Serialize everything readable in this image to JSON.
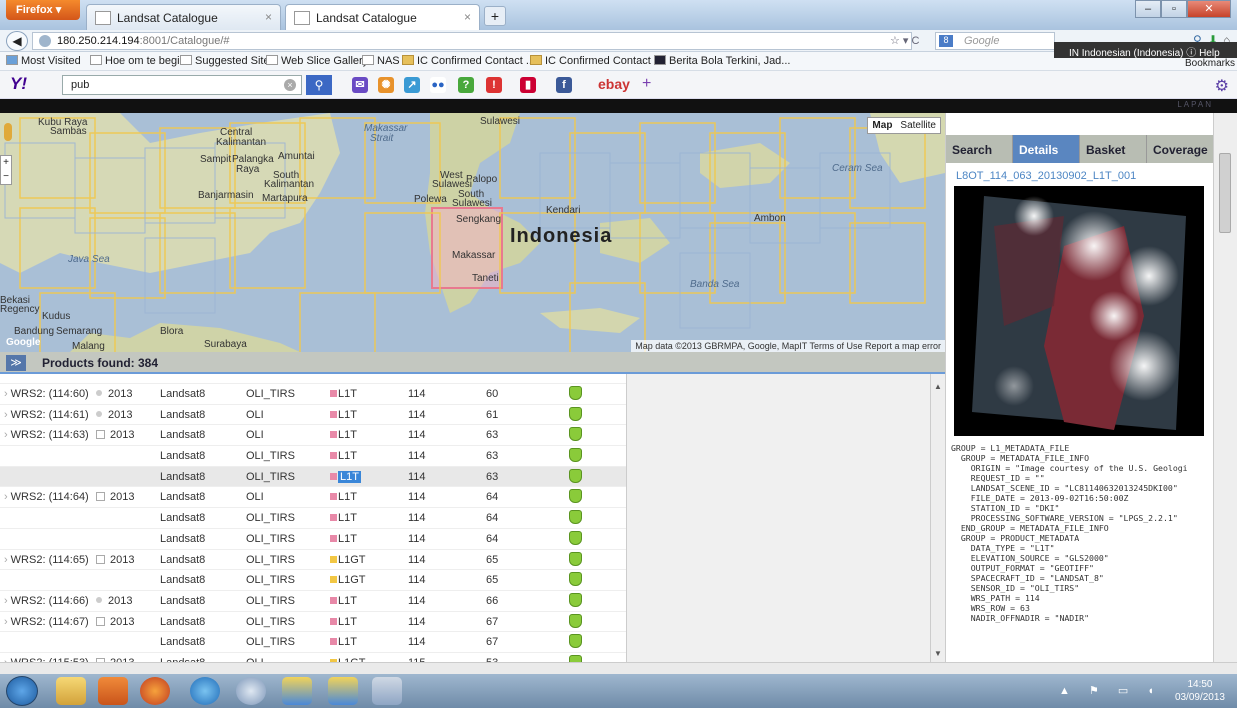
{
  "browser": {
    "menu_button": "Firefox ▾",
    "tabs": [
      {
        "label": "Landsat Catalogue"
      },
      {
        "label": "Landsat Catalogue"
      }
    ],
    "url_host": "180.250.214.194",
    "url_rest": ":8001/Catalogue/#",
    "nav_controls": "☆ ▾ C",
    "search_placeholder": "Google",
    "language_popup": "IN Indonesian (Indonesia)  ⓘ Help",
    "bookmarks_button": "Bookmarks",
    "bookmarks": [
      "Most Visited",
      "Hoe om te begin",
      "Suggested Sites",
      "Web Slice Gallery",
      "NAS",
      "IC Confirmed Contact ...",
      "IC Confirmed Contact ...",
      "Berita Bola Terkini, Jad..."
    ]
  },
  "yahoo": {
    "logo": "Y!",
    "query": "pub",
    "ebay": "ebay"
  },
  "app": {
    "brand": "LAPAN",
    "map": {
      "type_map": "Map",
      "type_satellite": "Satellite",
      "footer": "Map data ©2013 GBRMPA, Google, MapIT  Terms of Use  Report a map error",
      "labels": {
        "kubu": "Kubu Raya",
        "sambas": "Sambas",
        "central": "Central",
        "kalimantan": "Kalimantan",
        "makassar_strait": "Makassar",
        "strait": "Strait",
        "sulawesi": "Sulawesi",
        "sampit": "Sampit",
        "palangka": "Palangka",
        "raya": "Raya",
        "south": "South",
        "kalimantan2": "Kalimantan",
        "banjarmasin": "Banjarmasin",
        "martapura": "Martapura",
        "west": "West",
        "sulawesi2": "Sulawesi",
        "palopo": "Palopo",
        "polewa": "Polewa",
        "south2": "South",
        "sulawesi3": "Sulawesi",
        "sengkang": "Sengkang",
        "kendari": "Kendari",
        "indonesia": "Indonesia",
        "ceram_sea": "Ceram Sea",
        "ambon": "Ambon",
        "java_sea": "Java Sea",
        "makassar": "Makassar",
        "taneti": "Taneti",
        "banda_sea": "Banda Sea",
        "bekasi": "Bekasi",
        "regency": "Regency",
        "kudus": "Kudus",
        "bandung": "Bandung",
        "semarang": "Semarang",
        "blora": "Blora",
        "surabaya": "Surabaya",
        "malang": "Malang",
        "google": "Google",
        "muntai": "Amuntai"
      }
    },
    "products_header": "Products found: 384",
    "products": [
      {
        "wrs": "WRS2: (114:60)",
        "year": "2013",
        "sat": "Landsat8",
        "sensor": "OLI_TIRS",
        "level": "L1T",
        "level_color": "#e889a8",
        "path": "114",
        "row": "60",
        "group": false
      },
      {
        "wrs": "WRS2: (114:61)",
        "year": "2013",
        "sat": "Landsat8",
        "sensor": "OLI",
        "level": "L1T",
        "level_color": "#e889a8",
        "path": "114",
        "row": "61",
        "group": false
      },
      {
        "wrs": "WRS2: (114:63)",
        "year": "2013",
        "sat": "Landsat8",
        "sensor": "OLI",
        "level": "L1T",
        "level_color": "#e889a8",
        "path": "114",
        "row": "63",
        "group": true
      },
      {
        "wrs": "",
        "year": "",
        "sat": "Landsat8",
        "sensor": "OLI_TIRS",
        "level": "L1T",
        "level_color": "#e889a8",
        "path": "114",
        "row": "63",
        "group": false
      },
      {
        "wrs": "",
        "year": "",
        "sat": "Landsat8",
        "sensor": "OLI_TIRS",
        "level": "L1T",
        "level_color": "#e889a8",
        "path": "114",
        "row": "63",
        "group": false,
        "selected": true
      },
      {
        "wrs": "WRS2: (114:64)",
        "year": "2013",
        "sat": "Landsat8",
        "sensor": "OLI",
        "level": "L1T",
        "level_color": "#e889a8",
        "path": "114",
        "row": "64",
        "group": true
      },
      {
        "wrs": "",
        "year": "",
        "sat": "Landsat8",
        "sensor": "OLI_TIRS",
        "level": "L1T",
        "level_color": "#e889a8",
        "path": "114",
        "row": "64",
        "group": false
      },
      {
        "wrs": "",
        "year": "",
        "sat": "Landsat8",
        "sensor": "OLI_TIRS",
        "level": "L1T",
        "level_color": "#e889a8",
        "path": "114",
        "row": "64",
        "group": false
      },
      {
        "wrs": "WRS2: (114:65)",
        "year": "2013",
        "sat": "Landsat8",
        "sensor": "OLI_TIRS",
        "level": "L1GT",
        "level_color": "#f2c744",
        "path": "114",
        "row": "65",
        "group": true
      },
      {
        "wrs": "",
        "year": "",
        "sat": "Landsat8",
        "sensor": "OLI_TIRS",
        "level": "L1GT",
        "level_color": "#f2c744",
        "path": "114",
        "row": "65",
        "group": false
      },
      {
        "wrs": "WRS2: (114:66)",
        "year": "2013",
        "sat": "Landsat8",
        "sensor": "OLI_TIRS",
        "level": "L1T",
        "level_color": "#e889a8",
        "path": "114",
        "row": "66",
        "group": false
      },
      {
        "wrs": "WRS2: (114:67)",
        "year": "2013",
        "sat": "Landsat8",
        "sensor": "OLI_TIRS",
        "level": "L1T",
        "level_color": "#e889a8",
        "path": "114",
        "row": "67",
        "group": true
      },
      {
        "wrs": "",
        "year": "",
        "sat": "Landsat8",
        "sensor": "OLI_TIRS",
        "level": "L1T",
        "level_color": "#e889a8",
        "path": "114",
        "row": "67",
        "group": false
      },
      {
        "wrs": "WRS2: (115:53)",
        "year": "2013",
        "sat": "Landsat8",
        "sensor": "OLI",
        "level": "L1GT",
        "level_color": "#f2c744",
        "path": "115",
        "row": "53",
        "group": true
      }
    ],
    "right_panel": {
      "tabs": [
        "Search",
        "Details",
        "Basket",
        "Coverage"
      ],
      "active_tab": "Details",
      "scene_title": "L8OT_114_063_20130902_L1T_001",
      "metadata": "GROUP = L1_METADATA_FILE\n  GROUP = METADATA_FILE_INFO\n    ORIGIN = \"Image courtesy of the U.S. Geologi\n    REQUEST_ID = \"\"\n    LANDSAT_SCENE_ID = \"LC81140632013245DKI00\"\n    FILE_DATE = 2013-09-02T16:50:00Z\n    STATION_ID = \"DKI\"\n    PROCESSING_SOFTWARE_VERSION = \"LPGS_2.2.1\"\n  END_GROUP = METADATA_FILE_INFO\n  GROUP = PRODUCT_METADATA\n    DATA_TYPE = \"L1T\"\n    ELEVATION_SOURCE = \"GLS2000\"\n    OUTPUT_FORMAT = \"GEOTIFF\"\n    SPACECRAFT_ID = \"LANDSAT_8\"\n    SENSOR_ID = \"OLI_TIRS\"\n    WRS_PATH = 114\n    WRS_ROW = 63\n    NADIR_OFFNADIR = \"NADIR\""
    }
  },
  "taskbar": {
    "time": "14:50",
    "date": "03/09/2013"
  }
}
